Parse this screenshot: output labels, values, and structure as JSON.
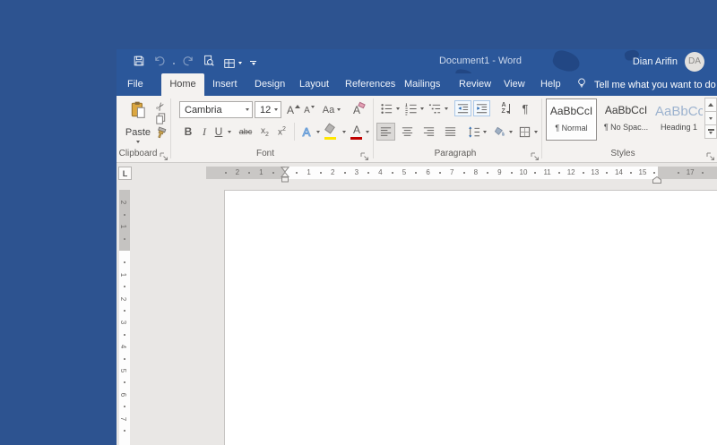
{
  "titlebar": {
    "title": "Document1 - Word",
    "user_name": "Dian Arifin",
    "user_initials": "DA"
  },
  "tabs": {
    "file": "File",
    "home": "Home",
    "insert": "Insert",
    "design": "Design",
    "layout": "Layout",
    "references": "References",
    "mailings": "Mailings",
    "review": "Review",
    "view": "View",
    "help": "Help",
    "tell_me": "Tell me what you want to do"
  },
  "ribbon": {
    "clipboard": {
      "label": "Clipboard",
      "paste_label": "Paste"
    },
    "font": {
      "label": "Font",
      "family_value": "Cambria",
      "size_value": "12",
      "bold": "B",
      "italic": "I",
      "underline": "U",
      "strikethrough": "abc",
      "subscript_base": "x",
      "subscript_mark": "2",
      "superscript_base": "x",
      "superscript_mark": "2",
      "grow": "A",
      "shrink": "A",
      "change_case": "Aa",
      "clear": "A",
      "effects": "A",
      "color": "A"
    },
    "paragraph": {
      "label": "Paragraph",
      "sort_a": "A",
      "sort_z": "Z",
      "pilcrow": "¶"
    },
    "styles": {
      "label": "Styles",
      "cards": [
        {
          "preview": "AaBbCcI",
          "name": "¶ Normal"
        },
        {
          "preview": "AaBbCcI",
          "name": "¶ No Spac..."
        },
        {
          "preview": "AaBbCc",
          "name": "Heading 1"
        }
      ]
    }
  },
  "ruler": {
    "tab_selector": "L",
    "h_margin_numbers": [
      "1",
      "2"
    ],
    "h_numbers": [
      "1",
      "2",
      "3",
      "4",
      "5",
      "6",
      "7",
      "8",
      "9",
      "10",
      "11",
      "12",
      "13",
      "14",
      "15"
    ],
    "h_right_number": "17",
    "v_margin_numbers": [
      "1",
      "2"
    ],
    "v_numbers": [
      "1",
      "2",
      "3",
      "4",
      "5",
      "6",
      "7"
    ]
  },
  "icons": {
    "scissors": "✂"
  },
  "colors": {
    "desktop": "#2d5390",
    "titlebar": "#2b579a",
    "ribbon_bg": "#f4f2f0",
    "accent": "#2b579a",
    "heading_preview": "#9db3cf",
    "highlight_yellow": "#ffe600",
    "font_color_red": "#c00000",
    "clipboard_tan": "#dca740",
    "canvas": "#e9e7e5"
  }
}
